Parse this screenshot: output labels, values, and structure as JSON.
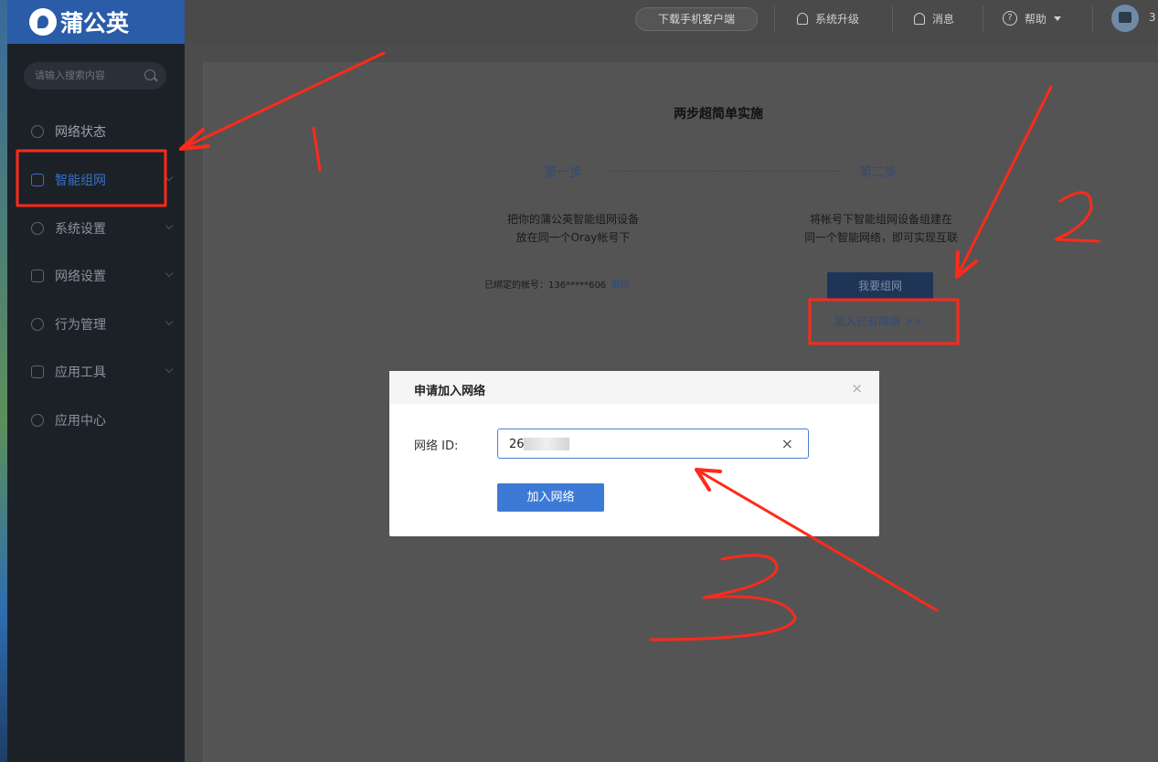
{
  "app": {
    "brand": "蒲公英",
    "accent": "#2a5ca8",
    "annotation_color": "#ff2a1a"
  },
  "sidebar": {
    "search_placeholder": "请输入搜索内容",
    "items": [
      {
        "label": "网络状态",
        "icon": "network-status-icon"
      },
      {
        "label": "智能组网",
        "icon": "smart-network-icon",
        "active": true
      },
      {
        "label": "系统设置",
        "icon": "system-settings-icon"
      },
      {
        "label": "网络设置",
        "icon": "network-settings-icon"
      },
      {
        "label": "行为管理",
        "icon": "behavior-management-icon"
      },
      {
        "label": "应用工具",
        "icon": "app-tools-icon"
      },
      {
        "label": "应用中心",
        "icon": "app-center-icon"
      }
    ]
  },
  "header": {
    "download_label": "下载手机客户端",
    "upgrade_label": "系统升级",
    "message_label": "消息",
    "help_label": "帮助",
    "user_prefix": "3"
  },
  "main": {
    "title": "两步超简单实施",
    "step1_label": "第一步",
    "step2_label": "第二步",
    "step1_line1": "把你的蒲公英智能组网设备",
    "step1_line2": "放在同一个Oray帐号下",
    "step2_line1": "将帐号下智能组网设备组建在",
    "step2_line2": "同一个智能网络，即可实现互联",
    "bound_label": "已绑定的帐号：136*****606",
    "unbind_label": "解绑",
    "create_network_label": "我要组网",
    "join_existing_label": "加入已有网络 >>"
  },
  "modal": {
    "title": "申请加入网络",
    "close_label": "×",
    "field_label": "网络 ID:",
    "field_value": "26",
    "clear_label": "×",
    "submit_label": "加入网络"
  },
  "annotations": {
    "numbers": [
      "1",
      "2",
      "3"
    ]
  }
}
